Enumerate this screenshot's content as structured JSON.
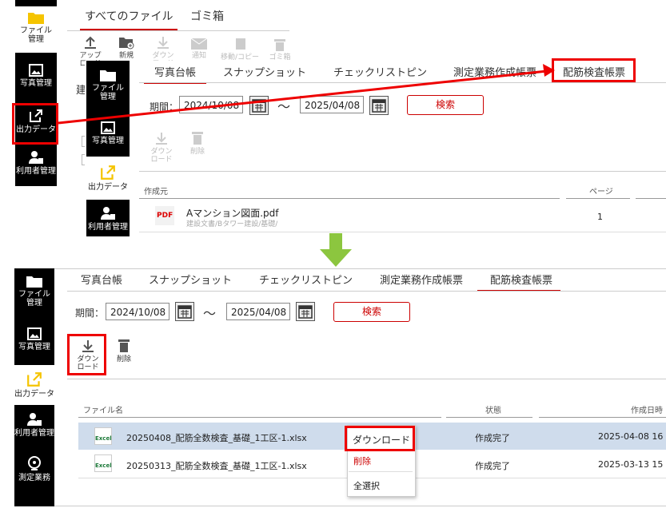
{
  "top": {
    "sidebar": [
      {
        "label": "ファイル\n管理",
        "icon": "folder-icon"
      },
      {
        "label": "写真管理",
        "icon": "image-icon"
      },
      {
        "label": "出力データ",
        "icon": "export-icon"
      },
      {
        "label": "利用者管理",
        "icon": "user-icon"
      }
    ],
    "tabs": [
      "すべてのファイル",
      "ゴミ箱"
    ],
    "toolbar": [
      "アップ\nロード",
      "新規",
      "ダウン\nロード",
      "通知",
      "移動/コピー",
      "ゴミ箱"
    ],
    "partial_text": "建",
    "colors": {
      "folder": "#f5c400",
      "highlight": "#e00000"
    }
  },
  "inset": {
    "sidebar": [
      {
        "label": "ファイル\n管理"
      },
      {
        "label": "写真管理"
      },
      {
        "label": "出力データ"
      },
      {
        "label": "利用者管理"
      }
    ],
    "tabs": [
      "写真台帳",
      "スナップショット",
      "チェックリストピン",
      "測定業務作成帳票",
      "配筋検査帳票"
    ],
    "period_label": "期間：",
    "date_from": "2024/10/08",
    "date_to": "2025/04/08",
    "tilde": "〜",
    "search_label": "検索",
    "download_label": "ダウン\nロード",
    "delete_label": "削除",
    "columns": [
      "作成元",
      "ページ"
    ],
    "file": {
      "name": "Aマンション図面.pdf",
      "path": "建設文書/Bタワー建設/基礎/",
      "pages": "1",
      "badge": "PDF"
    }
  },
  "bottom": {
    "sidebar": [
      {
        "label": "ファイル\n管理"
      },
      {
        "label": "写真管理"
      },
      {
        "label": "出力データ"
      },
      {
        "label": "利用者管理"
      },
      {
        "label": "測定業務"
      }
    ],
    "tabs": [
      "写真台帳",
      "スナップショット",
      "チェックリストピン",
      "測定業務作成帳票",
      "配筋検査帳票"
    ],
    "period_label": "期間：",
    "date_from": "2024/10/08",
    "date_to": "2025/04/08",
    "tilde": "〜",
    "search_label": "検索",
    "download_label": "ダウン\nロード",
    "delete_label": "削除",
    "columns": [
      "ファイル名",
      "状態",
      "作成日時"
    ],
    "rows": [
      {
        "name": "20250408_配筋全数検査_基礎_1工区-1.xlsx",
        "status": "作成完了",
        "date": "2025-04-08 16"
      },
      {
        "name": "20250313_配筋全数検査_基礎_1工区-1.xlsx",
        "status": "作成完了",
        "date": "2025-03-13 15"
      }
    ],
    "excel_badge": "Excel",
    "context_menu": [
      "ダウンロード",
      "削除",
      "全選択"
    ]
  }
}
